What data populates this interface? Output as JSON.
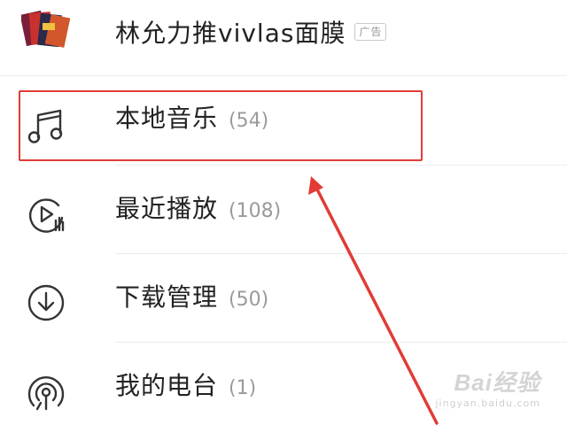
{
  "ad": {
    "title": "林允力推vivlas面膜",
    "badge": "广告",
    "thumb_icon": "ad-product-thumbnail"
  },
  "menu": [
    {
      "icon": "music-note-icon",
      "label": "本地音乐",
      "count": "(54)"
    },
    {
      "icon": "recent-play-icon",
      "label": "最近播放",
      "count": "(108)"
    },
    {
      "icon": "download-icon",
      "label": "下载管理",
      "count": "(50)"
    },
    {
      "icon": "radio-station-icon",
      "label": "我的电台",
      "count": "(1)"
    }
  ],
  "annotation": {
    "highlight_color": "#e23b36",
    "arrow_color": "#e23b36"
  },
  "watermark": {
    "main": "Bai经验",
    "sub": "jingyan.baidu.com"
  },
  "colors": {
    "text": "#222222",
    "count": "#9a9a9a",
    "icon": "#333333"
  }
}
